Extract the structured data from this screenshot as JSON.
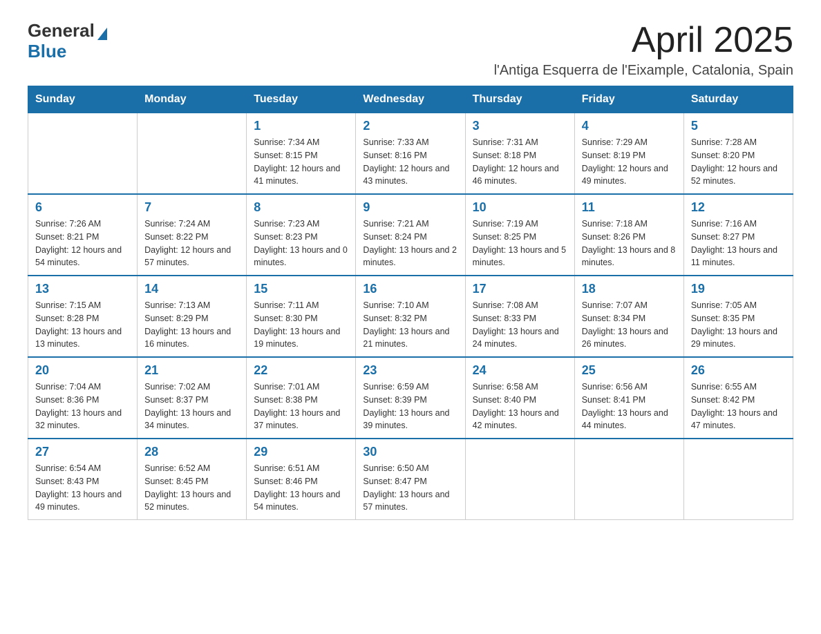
{
  "logo": {
    "text_general": "General",
    "text_blue": "Blue"
  },
  "header": {
    "month_year": "April 2025",
    "location": "l'Antiga Esquerra de l'Eixample, Catalonia, Spain"
  },
  "weekdays": [
    "Sunday",
    "Monday",
    "Tuesday",
    "Wednesday",
    "Thursday",
    "Friday",
    "Saturday"
  ],
  "weeks": [
    [
      {
        "day": "",
        "sunrise": "",
        "sunset": "",
        "daylight": ""
      },
      {
        "day": "",
        "sunrise": "",
        "sunset": "",
        "daylight": ""
      },
      {
        "day": "1",
        "sunrise": "Sunrise: 7:34 AM",
        "sunset": "Sunset: 8:15 PM",
        "daylight": "Daylight: 12 hours and 41 minutes."
      },
      {
        "day": "2",
        "sunrise": "Sunrise: 7:33 AM",
        "sunset": "Sunset: 8:16 PM",
        "daylight": "Daylight: 12 hours and 43 minutes."
      },
      {
        "day": "3",
        "sunrise": "Sunrise: 7:31 AM",
        "sunset": "Sunset: 8:18 PM",
        "daylight": "Daylight: 12 hours and 46 minutes."
      },
      {
        "day": "4",
        "sunrise": "Sunrise: 7:29 AM",
        "sunset": "Sunset: 8:19 PM",
        "daylight": "Daylight: 12 hours and 49 minutes."
      },
      {
        "day": "5",
        "sunrise": "Sunrise: 7:28 AM",
        "sunset": "Sunset: 8:20 PM",
        "daylight": "Daylight: 12 hours and 52 minutes."
      }
    ],
    [
      {
        "day": "6",
        "sunrise": "Sunrise: 7:26 AM",
        "sunset": "Sunset: 8:21 PM",
        "daylight": "Daylight: 12 hours and 54 minutes."
      },
      {
        "day": "7",
        "sunrise": "Sunrise: 7:24 AM",
        "sunset": "Sunset: 8:22 PM",
        "daylight": "Daylight: 12 hours and 57 minutes."
      },
      {
        "day": "8",
        "sunrise": "Sunrise: 7:23 AM",
        "sunset": "Sunset: 8:23 PM",
        "daylight": "Daylight: 13 hours and 0 minutes."
      },
      {
        "day": "9",
        "sunrise": "Sunrise: 7:21 AM",
        "sunset": "Sunset: 8:24 PM",
        "daylight": "Daylight: 13 hours and 2 minutes."
      },
      {
        "day": "10",
        "sunrise": "Sunrise: 7:19 AM",
        "sunset": "Sunset: 8:25 PM",
        "daylight": "Daylight: 13 hours and 5 minutes."
      },
      {
        "day": "11",
        "sunrise": "Sunrise: 7:18 AM",
        "sunset": "Sunset: 8:26 PM",
        "daylight": "Daylight: 13 hours and 8 minutes."
      },
      {
        "day": "12",
        "sunrise": "Sunrise: 7:16 AM",
        "sunset": "Sunset: 8:27 PM",
        "daylight": "Daylight: 13 hours and 11 minutes."
      }
    ],
    [
      {
        "day": "13",
        "sunrise": "Sunrise: 7:15 AM",
        "sunset": "Sunset: 8:28 PM",
        "daylight": "Daylight: 13 hours and 13 minutes."
      },
      {
        "day": "14",
        "sunrise": "Sunrise: 7:13 AM",
        "sunset": "Sunset: 8:29 PM",
        "daylight": "Daylight: 13 hours and 16 minutes."
      },
      {
        "day": "15",
        "sunrise": "Sunrise: 7:11 AM",
        "sunset": "Sunset: 8:30 PM",
        "daylight": "Daylight: 13 hours and 19 minutes."
      },
      {
        "day": "16",
        "sunrise": "Sunrise: 7:10 AM",
        "sunset": "Sunset: 8:32 PM",
        "daylight": "Daylight: 13 hours and 21 minutes."
      },
      {
        "day": "17",
        "sunrise": "Sunrise: 7:08 AM",
        "sunset": "Sunset: 8:33 PM",
        "daylight": "Daylight: 13 hours and 24 minutes."
      },
      {
        "day": "18",
        "sunrise": "Sunrise: 7:07 AM",
        "sunset": "Sunset: 8:34 PM",
        "daylight": "Daylight: 13 hours and 26 minutes."
      },
      {
        "day": "19",
        "sunrise": "Sunrise: 7:05 AM",
        "sunset": "Sunset: 8:35 PM",
        "daylight": "Daylight: 13 hours and 29 minutes."
      }
    ],
    [
      {
        "day": "20",
        "sunrise": "Sunrise: 7:04 AM",
        "sunset": "Sunset: 8:36 PM",
        "daylight": "Daylight: 13 hours and 32 minutes."
      },
      {
        "day": "21",
        "sunrise": "Sunrise: 7:02 AM",
        "sunset": "Sunset: 8:37 PM",
        "daylight": "Daylight: 13 hours and 34 minutes."
      },
      {
        "day": "22",
        "sunrise": "Sunrise: 7:01 AM",
        "sunset": "Sunset: 8:38 PM",
        "daylight": "Daylight: 13 hours and 37 minutes."
      },
      {
        "day": "23",
        "sunrise": "Sunrise: 6:59 AM",
        "sunset": "Sunset: 8:39 PM",
        "daylight": "Daylight: 13 hours and 39 minutes."
      },
      {
        "day": "24",
        "sunrise": "Sunrise: 6:58 AM",
        "sunset": "Sunset: 8:40 PM",
        "daylight": "Daylight: 13 hours and 42 minutes."
      },
      {
        "day": "25",
        "sunrise": "Sunrise: 6:56 AM",
        "sunset": "Sunset: 8:41 PM",
        "daylight": "Daylight: 13 hours and 44 minutes."
      },
      {
        "day": "26",
        "sunrise": "Sunrise: 6:55 AM",
        "sunset": "Sunset: 8:42 PM",
        "daylight": "Daylight: 13 hours and 47 minutes."
      }
    ],
    [
      {
        "day": "27",
        "sunrise": "Sunrise: 6:54 AM",
        "sunset": "Sunset: 8:43 PM",
        "daylight": "Daylight: 13 hours and 49 minutes."
      },
      {
        "day": "28",
        "sunrise": "Sunrise: 6:52 AM",
        "sunset": "Sunset: 8:45 PM",
        "daylight": "Daylight: 13 hours and 52 minutes."
      },
      {
        "day": "29",
        "sunrise": "Sunrise: 6:51 AM",
        "sunset": "Sunset: 8:46 PM",
        "daylight": "Daylight: 13 hours and 54 minutes."
      },
      {
        "day": "30",
        "sunrise": "Sunrise: 6:50 AM",
        "sunset": "Sunset: 8:47 PM",
        "daylight": "Daylight: 13 hours and 57 minutes."
      },
      {
        "day": "",
        "sunrise": "",
        "sunset": "",
        "daylight": ""
      },
      {
        "day": "",
        "sunrise": "",
        "sunset": "",
        "daylight": ""
      },
      {
        "day": "",
        "sunrise": "",
        "sunset": "",
        "daylight": ""
      }
    ]
  ]
}
